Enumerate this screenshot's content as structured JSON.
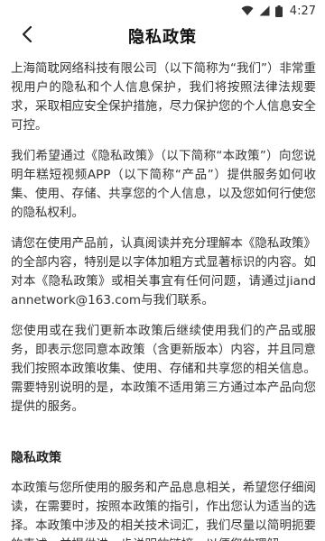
{
  "status_bar": {
    "time": "4:27",
    "icons": [
      "wifi-icon",
      "signal-icon",
      "battery-icon"
    ]
  },
  "header": {
    "back_icon": "chevron-left-icon",
    "title": "隐私政策"
  },
  "content": {
    "paragraphs": [
      "上海简耽网络科技有限公司（以下简称为“我们”）非常重视用户的隐私和个人信息保护，我们将按照法律法规要求，采取相应安全保护措施，尽力保护您的个人信息安全可控。",
      "我们希望通过《隐私政策》（以下简称“本政策”）向您说明年糕短视频APP（以下简称“产品”）提供服务如何收集、使用、存储、共享您的个人信息，以及您如何行使您的隐私权利。",
      "请您在使用产品前，认真阅读并充分理解本《隐私政策》的全部内容，特别是以字体加粗方式显著标识的内容。如对本《隐私政策》或相关事宜有任何问题，请通过jiandannetwork@163.com与我们联系。",
      "您使用或在我们更新本政策后继续使用我们的产品或服务，即表示您同意本政策（含更新版本）内容，并且同意我们按照本政策收集、使用、存储和共享您的相关信息。需要特别说明的是，本政策不适用第三方通过本产品向您提供的服务。"
    ],
    "section_title": "隐私政策",
    "section_paragraph": "本政策与您所使用的服务和产品息息相关，希望您仔细阅读，在需要时，按照本政策的指引，作出您认为适当的选择。本政策中涉及的相关技术词汇，我们尽量以简明扼要的表述，并提供进一步说明的链接，以便您的理解。"
  }
}
